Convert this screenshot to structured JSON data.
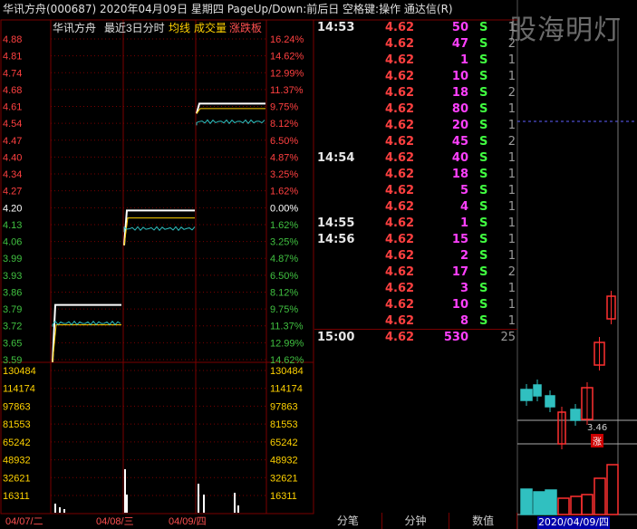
{
  "header": {
    "title": "华讯方舟(000687)  2020年04月09日 星期四 PageUp/Down:前后日 空格键:操作 通达信(R)",
    "watermark": "股海明灯"
  },
  "chart_header": {
    "label": "华讯方舟",
    "range": "最近3日分时",
    "avg_line": "均线",
    "volume": "成交量",
    "status": "涨跌板"
  },
  "colors": {
    "grid": "#7a0000",
    "price_line": "#ffffff",
    "avg_line": "#ffd200",
    "cyan_line": "#30c0c0",
    "up": "#ff3030",
    "down": "#30c0c0"
  },
  "chart_data": {
    "type": "line",
    "price_axis_left": [
      "4.88",
      "4.81",
      "4.74",
      "4.68",
      "4.61",
      "4.54",
      "4.47",
      "4.40",
      "4.34",
      "4.27",
      "4.20",
      "4.13",
      "4.06",
      "3.99",
      "3.93",
      "3.86",
      "3.79",
      "3.72",
      "3.65",
      "3.59"
    ],
    "price_axis_right": [
      "16.24%",
      "14.62%",
      "12.99%",
      "11.37%",
      "9.75%",
      "8.12%",
      "6.50%",
      "4.87%",
      "3.25%",
      "1.62%",
      "0.00%",
      "1.62%",
      "3.25%",
      "4.87%",
      "6.50%",
      "8.12%",
      "9.75%",
      "11.37%",
      "12.99%",
      "14.62%"
    ],
    "volume_axis": [
      "130484",
      "114174",
      "97863",
      "81553",
      "65242",
      "48932",
      "32621",
      "16311"
    ],
    "dates": [
      "04/07/二",
      "04/08/三",
      "04/09/四"
    ],
    "ylim": [
      3.59,
      4.88
    ],
    "days": [
      {
        "date": "04/07/二",
        "high": 3.81,
        "low": 3.58,
        "close": 3.81,
        "avg": 3.73
      },
      {
        "date": "04/08/三",
        "high": 4.19,
        "low": 4.05,
        "close": 4.19,
        "avg": 4.16
      },
      {
        "date": "04/09/四",
        "high": 4.62,
        "low": 4.58,
        "close": 4.62,
        "avg": 4.6
      }
    ]
  },
  "ticks": [
    {
      "time": "14:53",
      "price": "4.62",
      "vol": "50",
      "side": "S",
      "count": "1"
    },
    {
      "time": "",
      "price": "4.62",
      "vol": "47",
      "side": "S",
      "count": "2"
    },
    {
      "time": "",
      "price": "4.62",
      "vol": "1",
      "side": "S",
      "count": "1"
    },
    {
      "time": "",
      "price": "4.62",
      "vol": "10",
      "side": "S",
      "count": "1"
    },
    {
      "time": "",
      "price": "4.62",
      "vol": "18",
      "side": "S",
      "count": "2"
    },
    {
      "time": "",
      "price": "4.62",
      "vol": "80",
      "side": "S",
      "count": "1"
    },
    {
      "time": "",
      "price": "4.62",
      "vol": "20",
      "side": "S",
      "count": "1"
    },
    {
      "time": "",
      "price": "4.62",
      "vol": "45",
      "side": "S",
      "count": "2"
    },
    {
      "time": "14:54",
      "price": "4.62",
      "vol": "40",
      "side": "S",
      "count": "1"
    },
    {
      "time": "",
      "price": "4.62",
      "vol": "18",
      "side": "S",
      "count": "1"
    },
    {
      "time": "",
      "price": "4.62",
      "vol": "5",
      "side": "S",
      "count": "1"
    },
    {
      "time": "",
      "price": "4.62",
      "vol": "4",
      "side": "S",
      "count": "1"
    },
    {
      "time": "14:55",
      "price": "4.62",
      "vol": "1",
      "side": "S",
      "count": "1"
    },
    {
      "time": "14:56",
      "price": "4.62",
      "vol": "15",
      "side": "S",
      "count": "1"
    },
    {
      "time": "",
      "price": "4.62",
      "vol": "2",
      "side": "S",
      "count": "1"
    },
    {
      "time": "",
      "price": "4.62",
      "vol": "17",
      "side": "S",
      "count": "2"
    },
    {
      "time": "",
      "price": "4.62",
      "vol": "3",
      "side": "S",
      "count": "1"
    },
    {
      "time": "",
      "price": "4.62",
      "vol": "10",
      "side": "S",
      "count": "1"
    },
    {
      "time": "",
      "price": "4.62",
      "vol": "8",
      "side": "S",
      "count": "1"
    },
    {
      "time": "15:00",
      "price": "4.62",
      "vol": "530",
      "side": "",
      "count": "25"
    }
  ],
  "tabs": [
    "分笔",
    "分钟",
    "数值"
  ],
  "kline": {
    "date": "2020/04/09/四",
    "low_label": "3.46",
    "zhang": "涨"
  }
}
